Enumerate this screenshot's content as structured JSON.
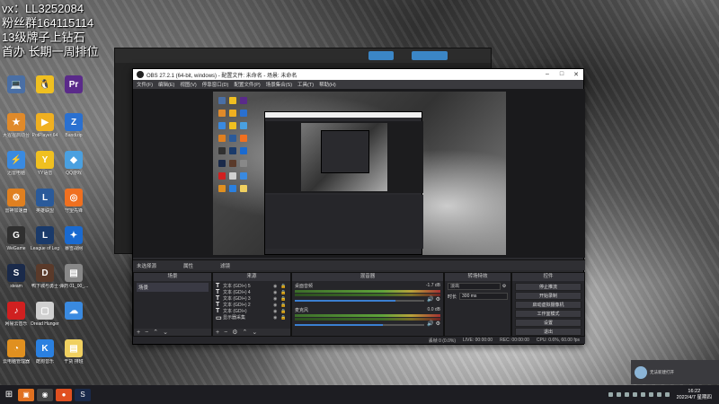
{
  "overlay": {
    "line1": "vx：LL3252084",
    "line2": "粉丝群164115114",
    "line3": "13级牌子上钻石",
    "line4": "首办 长期一周排位"
  },
  "desktop_icons": [
    {
      "label": "",
      "color": "#4a6fa5",
      "glyph": "💻"
    },
    {
      "label": "",
      "color": "#f0c020",
      "glyph": "🐧"
    },
    {
      "label": "",
      "color": "#5a2a8a",
      "glyph": "Pr"
    },
    {
      "label": "大猩猩启动台",
      "color": "#e08a2a",
      "glyph": "★"
    },
    {
      "label": "PotPlayer 64",
      "color": "#f0b020",
      "glyph": "▶"
    },
    {
      "label": "Bandizip",
      "color": "#2a70d0",
      "glyph": "Z"
    },
    {
      "label": "迅雷电脑",
      "color": "#3a8ae0",
      "glyph": "⚡"
    },
    {
      "label": "YY语音",
      "color": "#f0c020",
      "glyph": "Y"
    },
    {
      "label": "QQ游戏",
      "color": "#4aa0e0",
      "glyph": "◆"
    },
    {
      "label": "雷神加速器",
      "color": "#e08020",
      "glyph": "⚙"
    },
    {
      "label": "英雄联盟",
      "color": "#2a5a9a",
      "glyph": "L"
    },
    {
      "label": "守望先锋",
      "color": "#f07020",
      "glyph": "◎"
    },
    {
      "label": "WeGame",
      "color": "#303030",
      "glyph": "G"
    },
    {
      "label": "League of Legends",
      "color": "#1a3a6a",
      "glyph": "L"
    },
    {
      "label": "暴雪战网",
      "color": "#1a6ad0",
      "glyph": "✦"
    },
    {
      "label": "steam",
      "color": "#1a2a4a",
      "glyph": "S"
    },
    {
      "label": "鸭下城与勇士",
      "color": "#5a3a2a",
      "glyph": "D"
    },
    {
      "label": "弹药 01_00_...",
      "color": "#888888",
      "glyph": "▤"
    },
    {
      "label": "网易云音乐",
      "color": "#d02020",
      "glyph": "♪"
    },
    {
      "label": "Dread Hunger",
      "color": "#d0d0d0",
      "glyph": "▢"
    },
    {
      "label": "",
      "color": "#3a8ae0",
      "glyph": "☁"
    },
    {
      "label": "云电脑管理器",
      "color": "#e09020",
      "glyph": "◔"
    },
    {
      "label": "酷狗音乐",
      "color": "#2a80e0",
      "glyph": "K"
    },
    {
      "label": "干货 排班",
      "color": "#f0d060",
      "glyph": "▤"
    }
  ],
  "obs": {
    "title": "OBS 27.2.1 (64-bit, windows) - 配置文件: 未命名 - 场景: 未命名",
    "menu": [
      "文件(F)",
      "编辑(E)",
      "视图(V)",
      "停靠窗口(D)",
      "配置文件(P)",
      "场景集合(S)",
      "工具(T)",
      "帮助(H)"
    ],
    "toolbar": {
      "no_source": "未选择源",
      "properties": "属性",
      "filters": "滤镜"
    },
    "docks": {
      "scenes_title": "场景",
      "scenes": [
        "场景"
      ],
      "sources_title": "来源",
      "sources": [
        {
          "name": "文本 (GDI+) 5"
        },
        {
          "name": "文本 (GDI+) 4"
        },
        {
          "name": "文本 (GDI+) 3"
        },
        {
          "name": "文本 (GDI+) 2"
        },
        {
          "name": "文本 (GDI+)"
        },
        {
          "name": "显示器采集"
        }
      ],
      "mixer_title": "混音器",
      "mixer": [
        {
          "name": "桌面音频",
          "level": "-1.7 dB",
          "fill": 0.78
        },
        {
          "name": "麦克风",
          "level": "0.0 dB",
          "fill": 0.68
        }
      ],
      "transitions_title": "转场特效",
      "transition_type": "淡出",
      "duration_label": "时长",
      "duration_value": "300 ms",
      "controls_title": "控件",
      "controls": [
        "停止推流",
        "开始录制",
        "启动虚拟摄像机",
        "工作室模式",
        "设置",
        "退出"
      ]
    },
    "status": {
      "drop": "丢帧 0 (0.0%)",
      "live": "LIVE: 00:00:00",
      "rec": "REC: 00:00:00",
      "cpu": "CPU: 0.6%, 60.00 fps"
    }
  },
  "notification": {
    "text": "无法新建打开"
  },
  "clock": {
    "time": "16:22",
    "date": "2022/4/7 星期四"
  }
}
